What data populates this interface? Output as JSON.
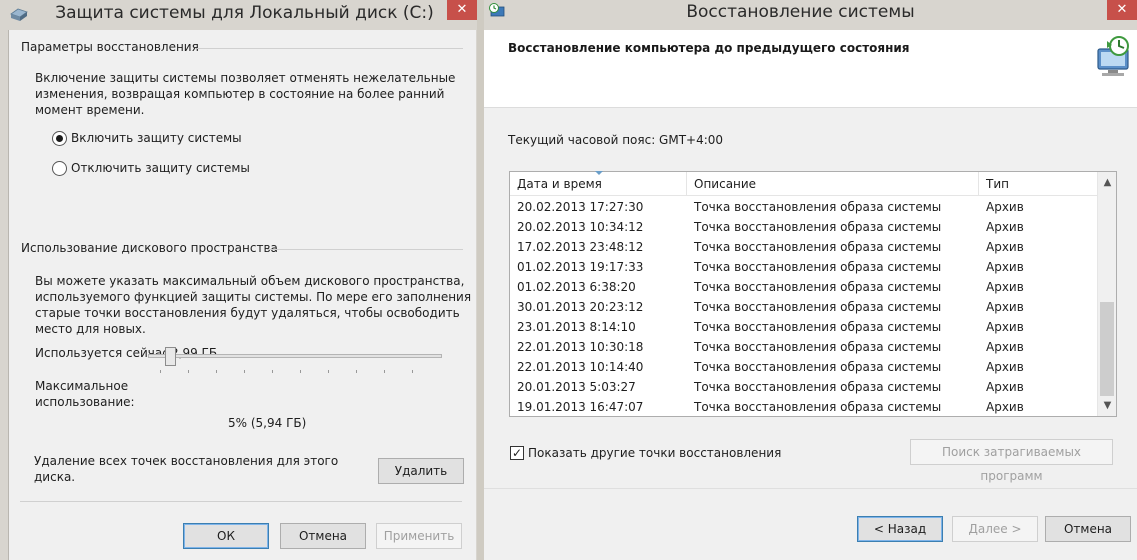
{
  "left_window": {
    "title": "Защита системы для Локальный диск (C:)",
    "close_glyph": "✕",
    "restore_group": {
      "heading": "Параметры восстановления",
      "description_lines": [
        "Включение защиты системы позволяет отменять нежелательные",
        "изменения, возвращая компьютер в состояние на более ранний",
        "момент времени."
      ],
      "options": [
        {
          "label": "Включить защиту системы",
          "selected": true
        },
        {
          "label": "Отключить защиту системы",
          "selected": false
        }
      ]
    },
    "disk_group": {
      "heading": "Использование дискового пространства",
      "description_lines": [
        "Вы можете указать максимальный объем дискового пространства,",
        "используемого функцией защиты системы. По мере его заполнения",
        "старые точки восстановления будут удаляться, чтобы освободить",
        "место для новых."
      ],
      "used_label": "Используется сейчас:",
      "used_value": "2,99 ГБ",
      "max_label_line1": "Максимальное",
      "max_label_line2": "использование:",
      "max_value_text": "5% (5,94 ГБ)",
      "max_fraction": 0.05,
      "delete_text_line1": "Удаление всех точек восстановления для этого",
      "delete_text_line2": "диска.",
      "delete_button": "Удалить"
    },
    "buttons": {
      "ok": "ОК",
      "cancel": "Отмена",
      "apply": "Применить"
    }
  },
  "right_window": {
    "title": "Восстановление системы",
    "close_glyph": "✕",
    "header_title": "Восстановление компьютера до предыдущего состояния",
    "timezone_text": "Текущий часовой пояс: GMT+4:00",
    "columns": [
      "Дата и время",
      "Описание",
      "Тип"
    ],
    "rows": [
      {
        "date": "20.02.2013 17:27:30",
        "desc": "Точка восстановления образа системы",
        "type": "Архив"
      },
      {
        "date": "20.02.2013 10:34:12",
        "desc": "Точка восстановления образа системы",
        "type": "Архив"
      },
      {
        "date": "17.02.2013 23:48:12",
        "desc": "Точка восстановления образа системы",
        "type": "Архив"
      },
      {
        "date": "01.02.2013 19:17:33",
        "desc": "Точка восстановления образа системы",
        "type": "Архив"
      },
      {
        "date": "01.02.2013 6:38:20",
        "desc": "Точка восстановления образа системы",
        "type": "Архив"
      },
      {
        "date": "30.01.2013 20:23:12",
        "desc": "Точка восстановления образа системы",
        "type": "Архив"
      },
      {
        "date": "23.01.2013 8:14:10",
        "desc": "Точка восстановления образа системы",
        "type": "Архив"
      },
      {
        "date": "22.01.2013 10:30:18",
        "desc": "Точка восстановления образа системы",
        "type": "Архив"
      },
      {
        "date": "22.01.2013 10:14:40",
        "desc": "Точка восстановления образа системы",
        "type": "Архив"
      },
      {
        "date": "20.01.2013 5:03:27",
        "desc": "Точка восстановления образа системы",
        "type": "Архив"
      },
      {
        "date": "19.01.2013 16:47:07",
        "desc": "Точка восстановления образа системы",
        "type": "Архив"
      }
    ],
    "scroll_up": "▲",
    "scroll_down": "▼",
    "show_more_checkbox": {
      "label": "Показать другие точки восстановления",
      "checked": true,
      "check_glyph": "✓"
    },
    "scan_button": "Поиск затрагиваемых программ",
    "buttons": {
      "back": "< Назад",
      "next": "Далее >",
      "cancel": "Отмена"
    }
  }
}
